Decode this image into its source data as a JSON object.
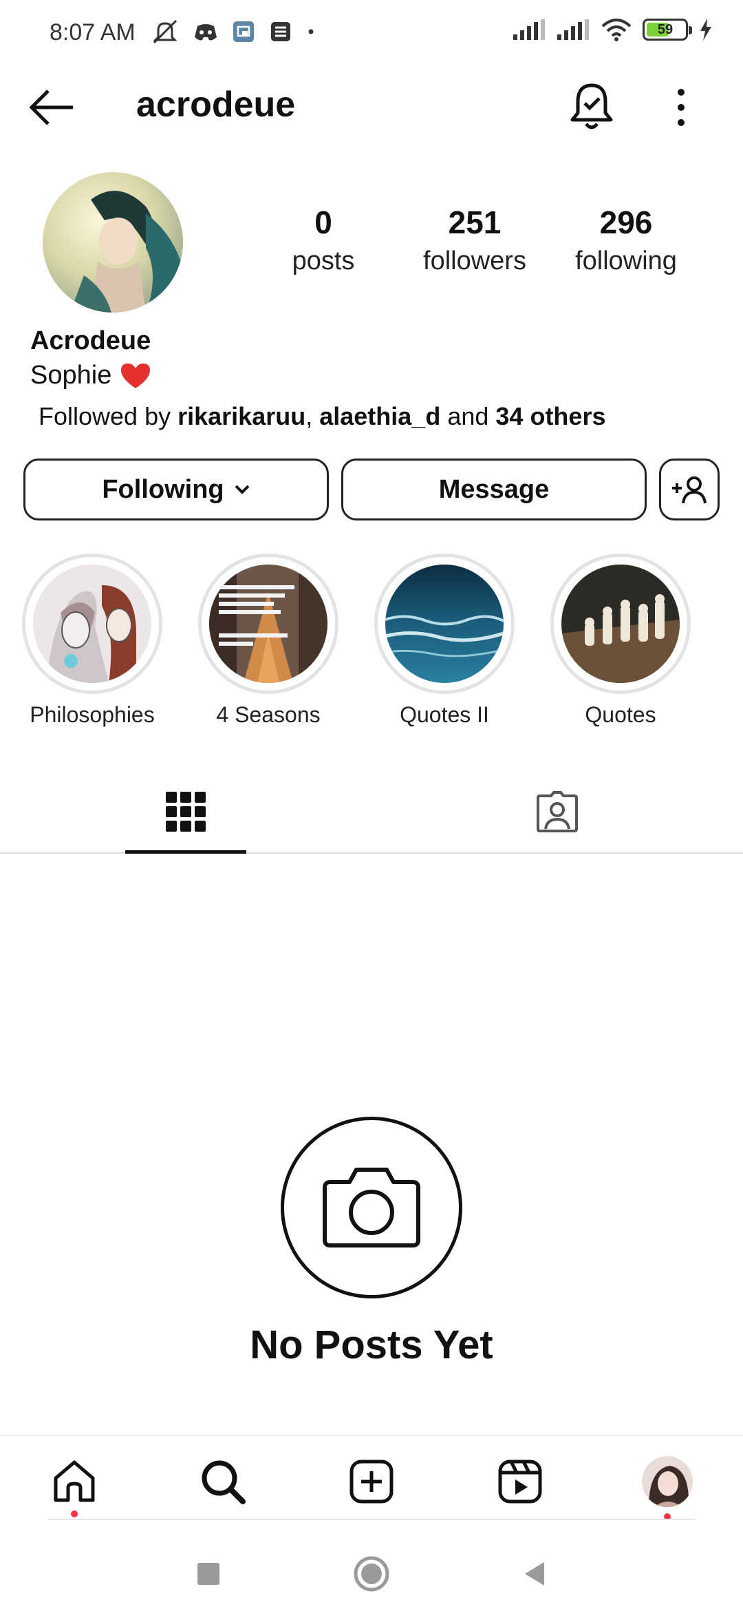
{
  "status_bar": {
    "time": "8:07 AM",
    "battery_level": "59",
    "battery_fraction": 0.59,
    "icons_left": [
      "mute-icon",
      "discord-icon",
      "cast-icon",
      "notes-icon",
      "dot-icon"
    ],
    "icons_right": [
      "signal-icon",
      "signal-icon",
      "wifi-icon",
      "battery-icon",
      "charging-icon"
    ]
  },
  "header": {
    "username": "acrodeue",
    "back_icon": "arrow-left-icon",
    "notifications_icon": "bell-check-icon",
    "menu_icon": "more-vertical-icon"
  },
  "profile": {
    "stats": [
      {
        "number": "0",
        "label": "posts"
      },
      {
        "number": "251",
        "label": "followers"
      },
      {
        "number": "296",
        "label": "following"
      }
    ],
    "display_name": "Acrodeue",
    "bio_text": "Sophie",
    "bio_emoji": "❤️",
    "followed_by_prefix": "Followed by ",
    "followed_by_user1": "rikarikaruu",
    "followed_by_sep": ", ",
    "followed_by_user2": "alaethia_d",
    "followed_by_and": " and ",
    "followed_by_others": "34 others"
  },
  "actions": {
    "following_label": "Following",
    "message_label": "Message"
  },
  "highlights": [
    {
      "label": "Philosophies"
    },
    {
      "label": "4 Seasons"
    },
    {
      "label": "Quotes II"
    },
    {
      "label": "Quotes"
    }
  ],
  "tabs": [
    {
      "name": "grid",
      "icon": "grid-icon",
      "active": true
    },
    {
      "name": "tagged",
      "icon": "tagged-person-icon",
      "active": false
    }
  ],
  "empty_state": {
    "title": "No Posts Yet",
    "icon": "camera-icon"
  },
  "bottom_nav": [
    {
      "name": "home",
      "icon": "home-icon",
      "badge": true
    },
    {
      "name": "search",
      "icon": "search-icon",
      "badge": false
    },
    {
      "name": "create",
      "icon": "plus-square-icon",
      "badge": false
    },
    {
      "name": "reels",
      "icon": "reels-icon",
      "badge": false
    },
    {
      "name": "profile",
      "icon": "profile-avatar-icon",
      "badge": true
    }
  ],
  "colors": {
    "text": "#111111",
    "badge": "#ff3040",
    "heart": "#e5302f",
    "battery_fill": "#7bd13a",
    "highlight_ring": "#e3e3e3"
  }
}
